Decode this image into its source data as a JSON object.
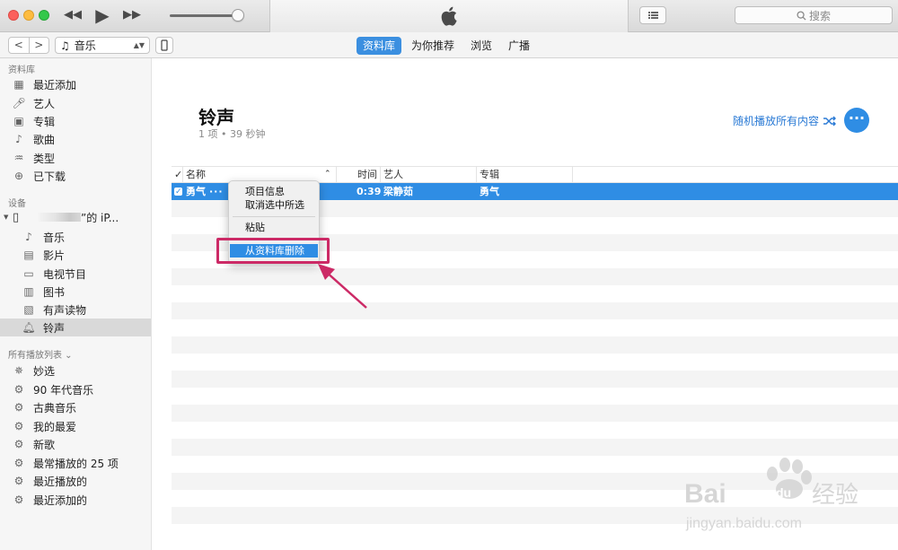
{
  "window": {
    "search_placeholder": "搜索",
    "media_kind": "音乐"
  },
  "tabs": [
    {
      "label": "资料库",
      "active": true
    },
    {
      "label": "为你推荐",
      "active": false
    },
    {
      "label": "浏览",
      "active": false
    },
    {
      "label": "广播",
      "active": false
    }
  ],
  "sidebar": {
    "library_header": "资料库",
    "library": [
      {
        "label": "最近添加",
        "icon": "grid-icon"
      },
      {
        "label": "艺人",
        "icon": "microphone-icon"
      },
      {
        "label": "专辑",
        "icon": "album-icon"
      },
      {
        "label": "歌曲",
        "icon": "note-icon"
      },
      {
        "label": "类型",
        "icon": "genre-icon"
      },
      {
        "label": "已下载",
        "icon": "download-icon"
      }
    ],
    "devices_header": "设备",
    "device_name_suffix": "”的 iP...",
    "device_items": [
      {
        "label": "音乐",
        "icon": "note-icon",
        "selected": false
      },
      {
        "label": "影片",
        "icon": "film-icon",
        "selected": false
      },
      {
        "label": "电视节目",
        "icon": "tv-icon",
        "selected": false
      },
      {
        "label": "图书",
        "icon": "book-icon",
        "selected": false
      },
      {
        "label": "有声读物",
        "icon": "audiobook-icon",
        "selected": false
      },
      {
        "label": "铃声",
        "icon": "bell-icon",
        "selected": true
      }
    ],
    "playlists_header": "所有播放列表",
    "playlists": [
      {
        "label": "妙选",
        "icon": "genius-icon"
      },
      {
        "label": "90 年代音乐",
        "icon": "gear-icon"
      },
      {
        "label": "古典音乐",
        "icon": "gear-icon"
      },
      {
        "label": "我的最爱",
        "icon": "gear-icon"
      },
      {
        "label": "新歌",
        "icon": "gear-icon"
      },
      {
        "label": "最常播放的 25 项",
        "icon": "gear-icon"
      },
      {
        "label": "最近播放的",
        "icon": "gear-icon"
      },
      {
        "label": "最近添加的",
        "icon": "gear-icon"
      }
    ]
  },
  "main": {
    "title": "铃声",
    "summary": "1 项 • 39 秒钟",
    "shuffle_label": "随机播放所有内容",
    "more_label": "···",
    "columns": {
      "check": "✓",
      "name": "名称",
      "time": "时间",
      "artist": "艺人",
      "album": "专辑"
    },
    "rows": [
      {
        "name": "勇气",
        "dots": "···",
        "time": "0:39",
        "artist": "梁静茹",
        "album": "勇气"
      }
    ]
  },
  "context_menu": {
    "items": [
      "项目信息",
      "取消选中所选",
      "粘贴",
      "从资料库删除"
    ],
    "highlighted": "从资料库删除"
  },
  "watermark": {
    "brand": "Bai",
    "brand_suffix": "du",
    "product": "经验",
    "url": "jingyan.baidu.com"
  },
  "colors": {
    "accent": "#2f8de4",
    "annotation": "#cc2a66"
  }
}
